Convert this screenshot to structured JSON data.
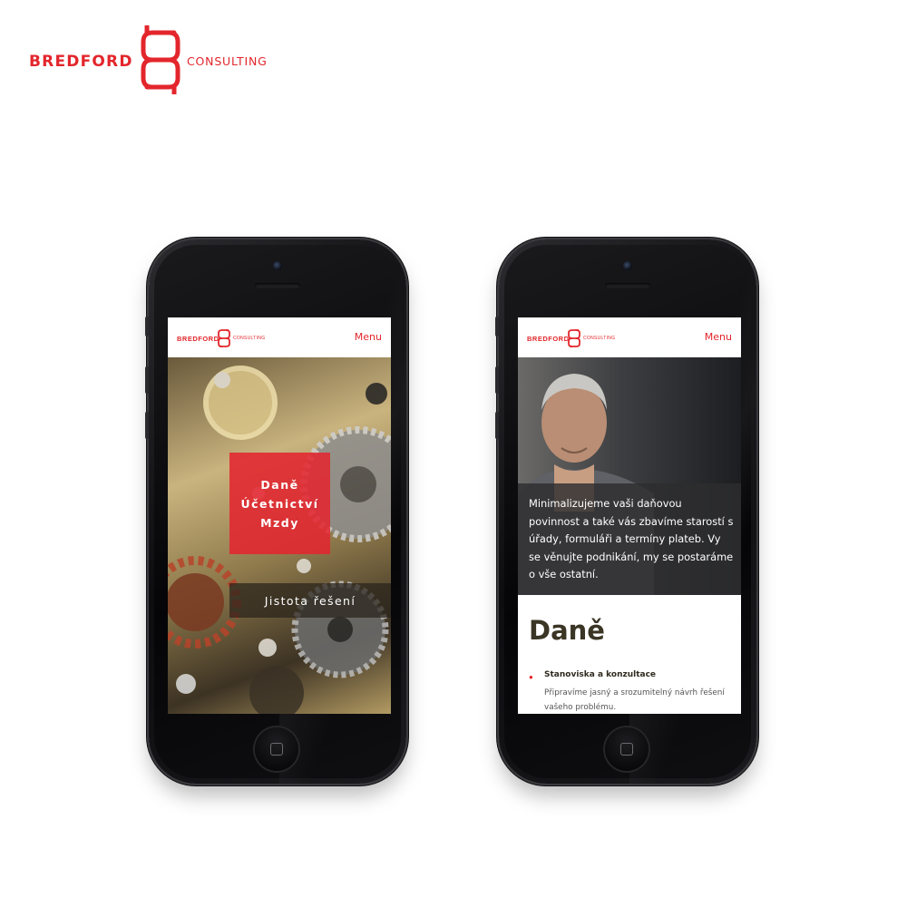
{
  "brand": {
    "name": "BREDFORD",
    "tagline": "CONSULTING",
    "color": "#e3262c"
  },
  "phones": [
    {
      "header": {
        "logo_name": "BREDFORD",
        "logo_tagline": "CONSULTING",
        "menu_label": "Menu"
      },
      "hero": {
        "services": [
          "Daně",
          "Účetnictví",
          "Mzdy"
        ],
        "tagline": "Jistota řešení"
      }
    },
    {
      "header": {
        "logo_name": "BREDFORD",
        "logo_tagline": "CONSULTING",
        "menu_label": "Menu"
      },
      "intro": "Minimalizujeme vaši daňovou povinnost a také vás zbavíme starostí s úřady, formuláři a termíny plateb. Vy se věnujte podnikání, my se postaráme o vše ostatní.",
      "section_title": "Daně",
      "items": [
        {
          "title": "Stanoviska a konzultace",
          "description": "Připravíme jasný a srozumitelný návrh řešení vašeho problému."
        }
      ]
    }
  ]
}
